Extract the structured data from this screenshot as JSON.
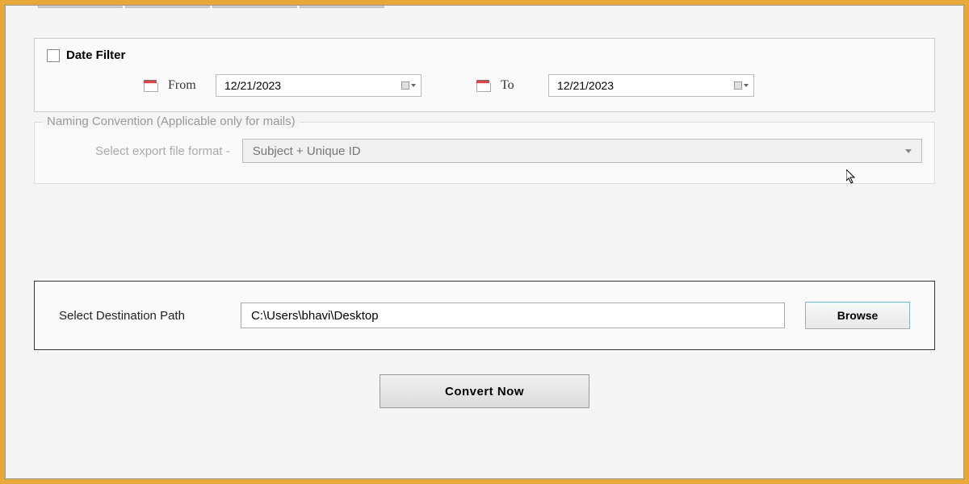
{
  "dateFilter": {
    "title": "Date Filter",
    "checked": false,
    "fromLabel": "From",
    "fromValue": "12/21/2023",
    "toLabel": "To",
    "toValue": "12/21/2023"
  },
  "namingConvention": {
    "legend": "Naming Convention (Applicable only for mails)",
    "label": "Select export file format -",
    "selectedValue": "Subject + Unique ID"
  },
  "destination": {
    "label": "Select Destination Path",
    "pathValue": "C:\\Users\\bhavi\\Desktop",
    "browseLabel": "Browse"
  },
  "actions": {
    "convertLabel": "Convert Now"
  }
}
